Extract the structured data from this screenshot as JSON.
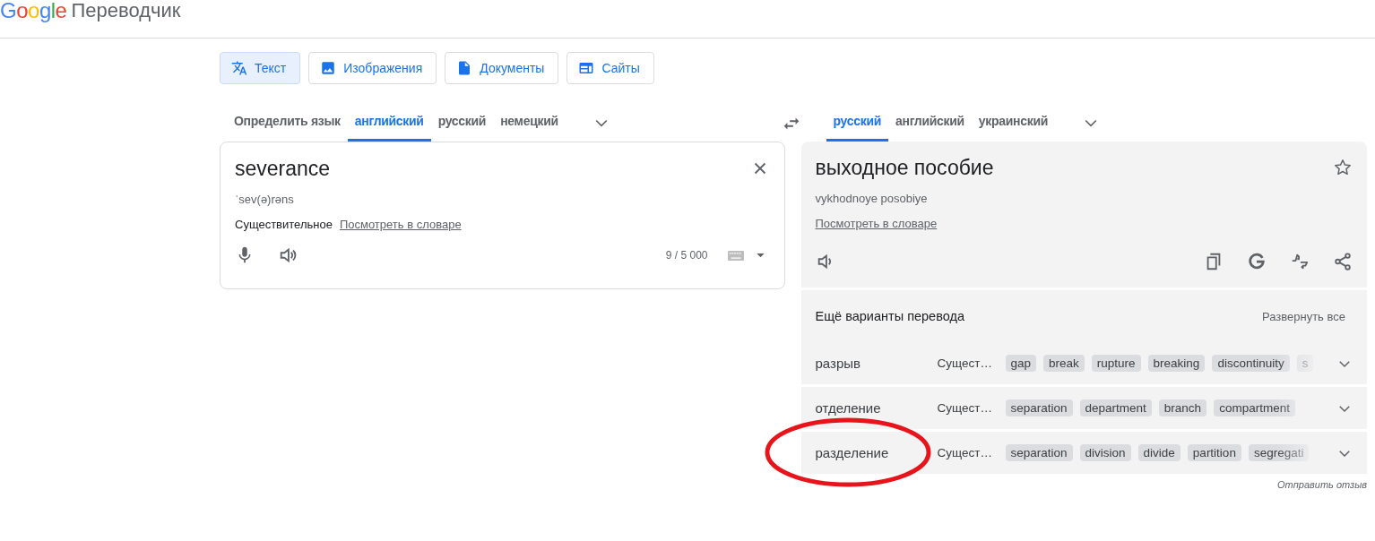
{
  "header": {
    "logo": "Google",
    "title": "Переводчик"
  },
  "modes": [
    {
      "label": "Текст",
      "kind": "translate",
      "selected": true
    },
    {
      "label": "Изображения",
      "kind": "image",
      "selected": false
    },
    {
      "label": "Документы",
      "kind": "document",
      "selected": false
    },
    {
      "label": "Сайты",
      "kind": "website",
      "selected": false
    }
  ],
  "source_langs": [
    {
      "label": "Определить язык",
      "selected": false
    },
    {
      "label": "английский",
      "selected": true
    },
    {
      "label": "русский",
      "selected": false
    },
    {
      "label": "немецкий",
      "selected": false
    }
  ],
  "target_langs": [
    {
      "label": "русский",
      "selected": true
    },
    {
      "label": "английский",
      "selected": false
    },
    {
      "label": "украинский",
      "selected": false
    }
  ],
  "source": {
    "text": "severance",
    "phonetic": "ˈsev(ə)rəns",
    "part_of_speech": "Существительное",
    "dict_link": "Посмотреть в словаре",
    "counter": "9 / 5 000"
  },
  "target": {
    "text": "выходное пособие",
    "transliteration": "vykhodnoye posobiye",
    "dict_link": "Посмотреть в словаре"
  },
  "alternatives": {
    "title": "Ещё варианты перевода",
    "expand_all": "Развернуть все",
    "rows": [
      {
        "word": "разрыв",
        "pos": "Сущест…",
        "synonyms": [
          "gap",
          "break",
          "rupture",
          "breaking",
          "discontinuity",
          "s"
        ]
      },
      {
        "word": "отделение",
        "pos": "Сущест…",
        "synonyms": [
          "separation",
          "department",
          "branch",
          "compartment"
        ]
      },
      {
        "word": "разделение",
        "pos": "Сущест…",
        "synonyms": [
          "separation",
          "division",
          "divide",
          "partition",
          "segregati"
        ]
      }
    ]
  },
  "feedback": "Отправить отзыв",
  "annotation": {
    "kind": "ellipse",
    "color": "#e8141c"
  }
}
